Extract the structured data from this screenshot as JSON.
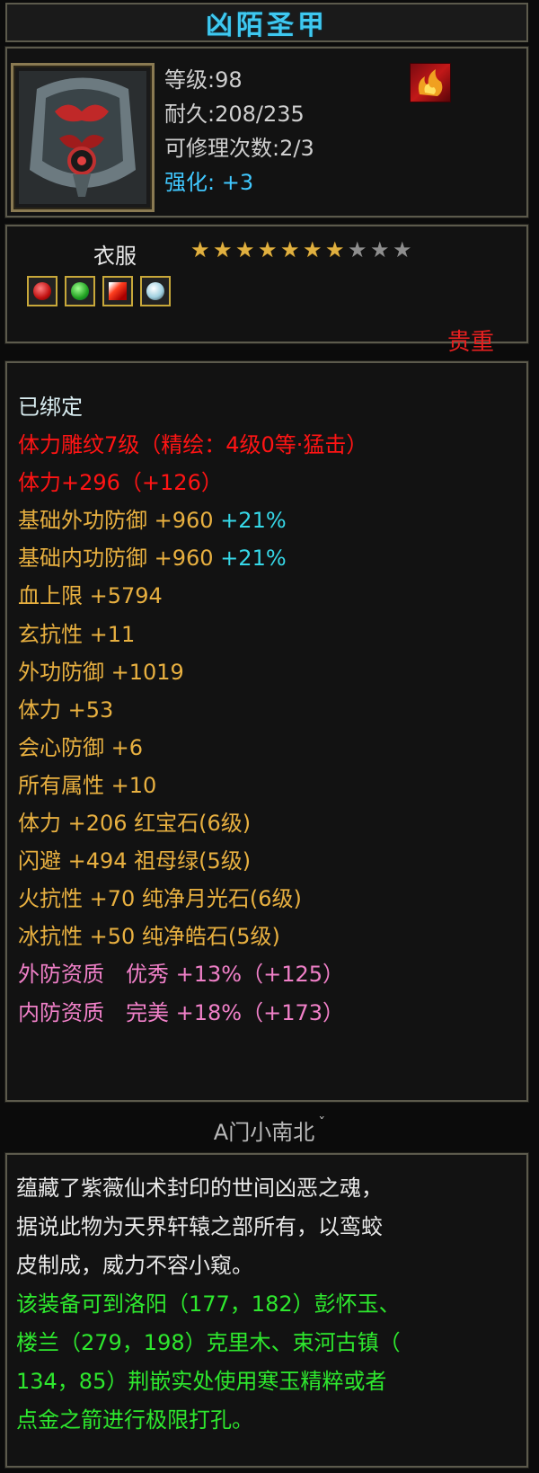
{
  "item": {
    "name": "凶陌圣甲",
    "level_label": "等级:98",
    "durability_label": "耐久:208/235",
    "repair_label": "可修理次数:2/3",
    "enhance_key": "强化:",
    "enhance_value": "+3",
    "category": "衣服",
    "stars_total": 10,
    "stars_filled": 7,
    "rarity": "贵重",
    "socket_gems": [
      "red-gem-icon",
      "green-gem-icon",
      "flame-gem-icon",
      "moon-gem-icon"
    ]
  },
  "attributes": {
    "bound": "已绑定",
    "carving": "体力雕纹7级（精绘：4级0等·猛击）",
    "stamina_total": "体力+296（+126）",
    "base_outer_def": "基础外功防御 +960",
    "base_outer_def_pct": "+21%",
    "base_inner_def": "基础内功防御 +960",
    "base_inner_def_pct": "+21%",
    "hp_max": "血上限 +5794",
    "mystic_res": "玄抗性 +11",
    "outer_def": "外功防御 +1019",
    "stamina": "体力 +53",
    "crit_def": "会心防御 +6",
    "all_attr": "所有属性 +10",
    "gem_line_1": "体力 +206 红宝石(6级)",
    "gem_line_2": "闪避 +494 祖母绿(5级)",
    "gem_line_3": "火抗性 +70 纯净月光石(6级)",
    "gem_line_4": "冰抗性 +50 纯净皓石(5级)",
    "outer_quality": "外防资质　优秀 +13%（+125）",
    "inner_quality": "内防资质　完美 +18%（+173）"
  },
  "maker": "A门小南北",
  "description": {
    "lore_1": "蕴藏了紫薇仙术封印的世间凶恶之魂，",
    "lore_2": "据说此物为天界轩辕之部所有，以鸾蛟",
    "lore_3": "皮制成，威力不容小窥。",
    "hint_1": "该装备可到洛阳（177，182）彭怀玉、",
    "hint_2": "楼兰（279，198）克里木、束河古镇（",
    "hint_3": "134，85）荆嵌实处使用寒玉精粹或者",
    "hint_4": "点金之箭进行极限打孔。"
  },
  "colors": {
    "title": "#3ec8f0",
    "carving": "#ff1414",
    "attribute": "#e8b040",
    "percent": "#36d8e8",
    "quality": "#f080c8",
    "hint": "#2ee82e",
    "rarity": "#e82020"
  }
}
